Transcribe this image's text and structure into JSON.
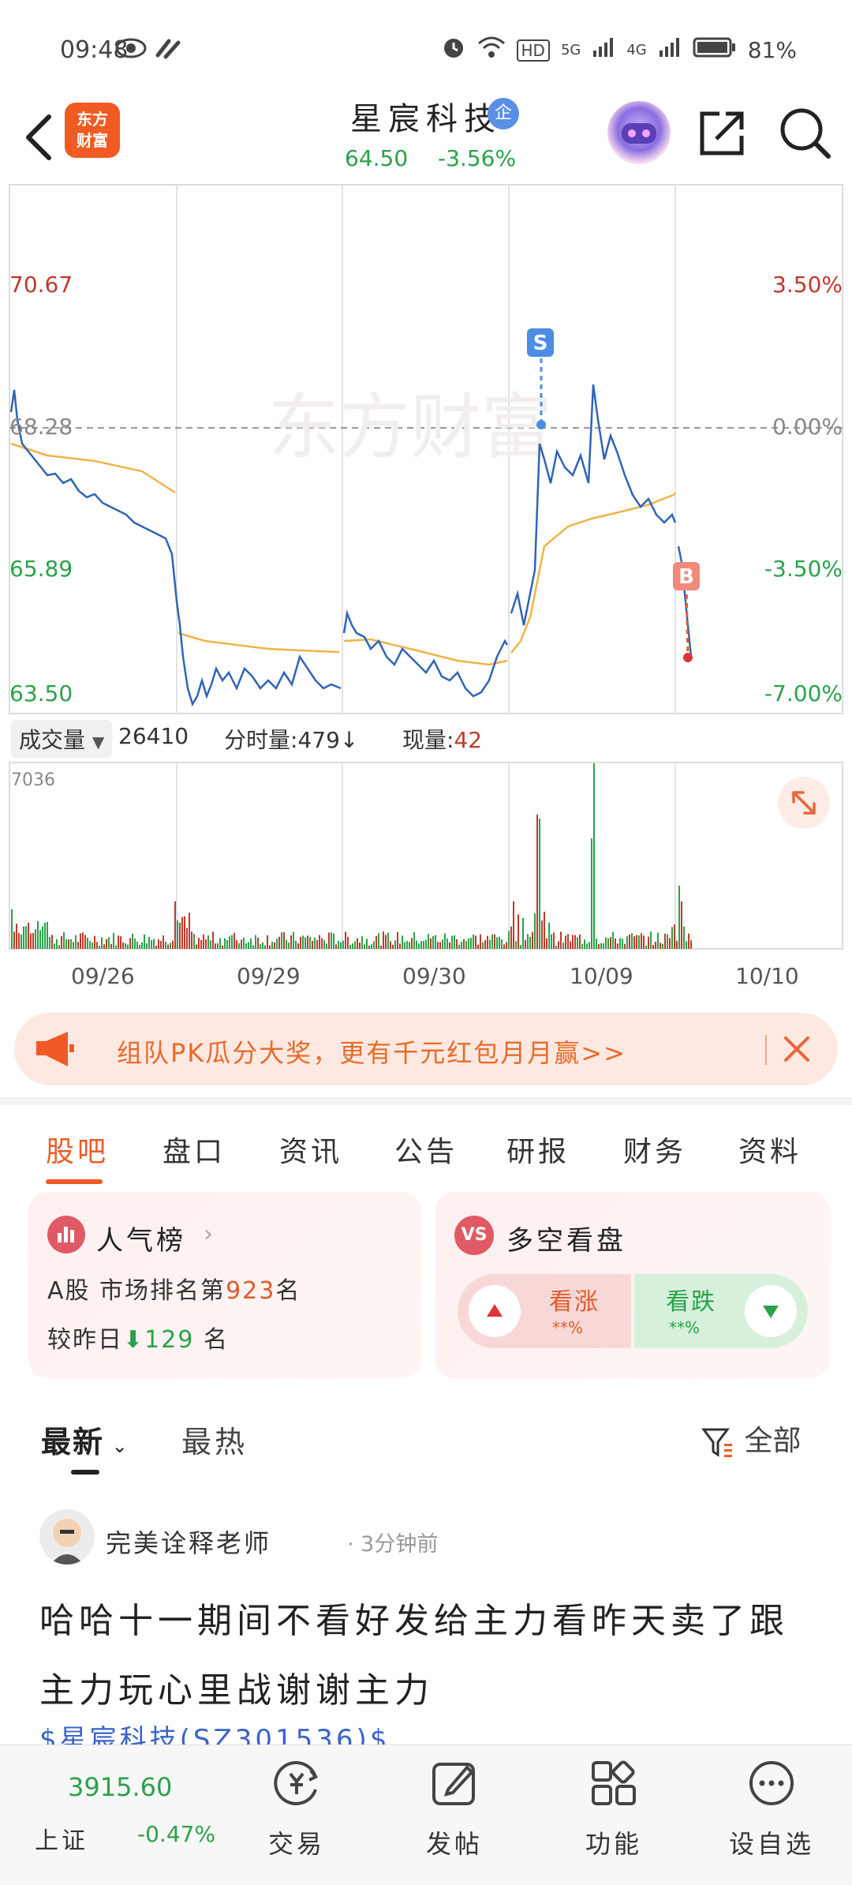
{
  "status_bar": {
    "time": "09:48",
    "battery": "81%",
    "network": [
      "HD",
      "5G",
      "4G"
    ]
  },
  "header": {
    "app_logo": "东方\n财富",
    "stock_name": "星宸科技",
    "badge": "企",
    "price": "64.50",
    "change": "-3.56%"
  },
  "chart": {
    "watermark": "东方财富",
    "y_left": [
      "70.67",
      "68.28",
      "65.89",
      "63.50"
    ],
    "y_right": [
      "3.50%",
      "0.00%",
      "-3.50%",
      "-7.00%"
    ],
    "markers": {
      "sell": "S",
      "buy": "B"
    },
    "colors": {
      "up": "#c0392b",
      "down": "#2aa14a",
      "price_line": "#2f64b5",
      "avg_line": "#f0b347",
      "accent": "#ef5b24"
    }
  },
  "chart_data": {
    "type": "line",
    "title": "",
    "x_dates": [
      "09/26",
      "09/29",
      "09/30",
      "10/09",
      "10/10"
    ],
    "ylim": [
      63.5,
      70.67
    ],
    "reference_price": 68.28,
    "series": []
  },
  "volume": {
    "selector_label": "成交量",
    "total": "26410",
    "fs_label": "分时量:",
    "fs_value": "479",
    "xl_label": "现量:",
    "xl_value": "42",
    "max": "7036"
  },
  "promo": {
    "text": "组队PK瓜分大奖，更有千元红包月月赢>>"
  },
  "tabs": [
    "股吧",
    "盘口",
    "资讯",
    "公告",
    "研报",
    "财务",
    "资料"
  ],
  "popularity": {
    "title": "人气榜",
    "rank_prefix": "A股 市场排名第",
    "rank": "923",
    "rank_suffix": "名",
    "change_prefix": "较昨日",
    "change": "129",
    "change_suffix": "名"
  },
  "vs": {
    "badge": "VS",
    "title": "多空看盘",
    "up_label": "看涨",
    "up_value": "**%",
    "down_label": "看跌",
    "down_value": "**%"
  },
  "sort": {
    "latest": "最新",
    "hot": "最热",
    "filter": "全部"
  },
  "post": {
    "author": "完美诠释老师",
    "time": "· 3分钟前",
    "body": "哈哈十一期间不看好发给主力看昨天卖了跟主力玩心里战谢谢主力",
    "tag": "$星宸科技(SZ301536)$"
  },
  "bottom_nav": {
    "index_value": "3915.60",
    "index_name": "上证",
    "index_change": "-0.47%",
    "items": [
      "交易",
      "发帖",
      "功能",
      "设自选"
    ]
  }
}
